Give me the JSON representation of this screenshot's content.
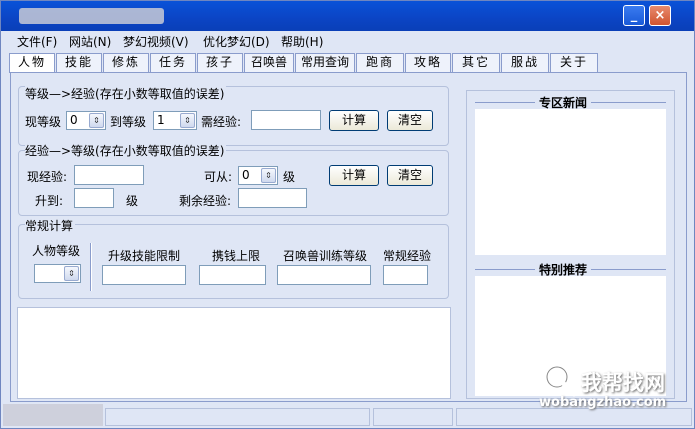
{
  "window": {
    "minimize_glyph": "_",
    "close_glyph": "×"
  },
  "menu": [
    "文件(F)",
    "网站(N)",
    "梦幻视频(V)",
    "优化梦幻(D)",
    "帮助(H)"
  ],
  "tabs": [
    "人物",
    "技能",
    "修炼",
    "任务",
    "孩子",
    "召唤兽",
    "常用查询",
    "跑商",
    "攻略",
    "其它",
    "服战",
    "关于"
  ],
  "level_to_exp": {
    "title": "等级—>经验(存在小数等取值的误差)",
    "current_level_label": "现等级",
    "current_level_value": "0",
    "to_level_label": "到等级",
    "to_level_value": "1",
    "need_exp_label": "需经验:",
    "need_exp_value": "",
    "calc_button": "计算",
    "clear_button": "清空"
  },
  "exp_to_level": {
    "title": "经验—>等级(存在小数等取值的误差)",
    "current_exp_label": "现经验:",
    "current_exp_value": "",
    "from_label": "可从:",
    "from_value": "0",
    "level_unit": "级",
    "rise_to_label": "升到:",
    "rise_to_value": "",
    "level_unit2": "级",
    "remaining_exp_label": "剩余经验:",
    "remaining_exp_value": "",
    "calc_button": "计算",
    "clear_button": "清空"
  },
  "regular_calc": {
    "title": "常规计算",
    "char_level_label": "人物等级",
    "char_level_value": "",
    "skill_limit_label": "升级技能限制",
    "money_limit_label": "携钱上限",
    "pet_train_label": "召唤兽训练等级",
    "regular_exp_label": "常规经验"
  },
  "side": {
    "news_title": "专区新闻",
    "recommend_title": "特别推荐"
  },
  "watermark": {
    "main": "我帮找网",
    "sub": "wobangzhao.com"
  }
}
